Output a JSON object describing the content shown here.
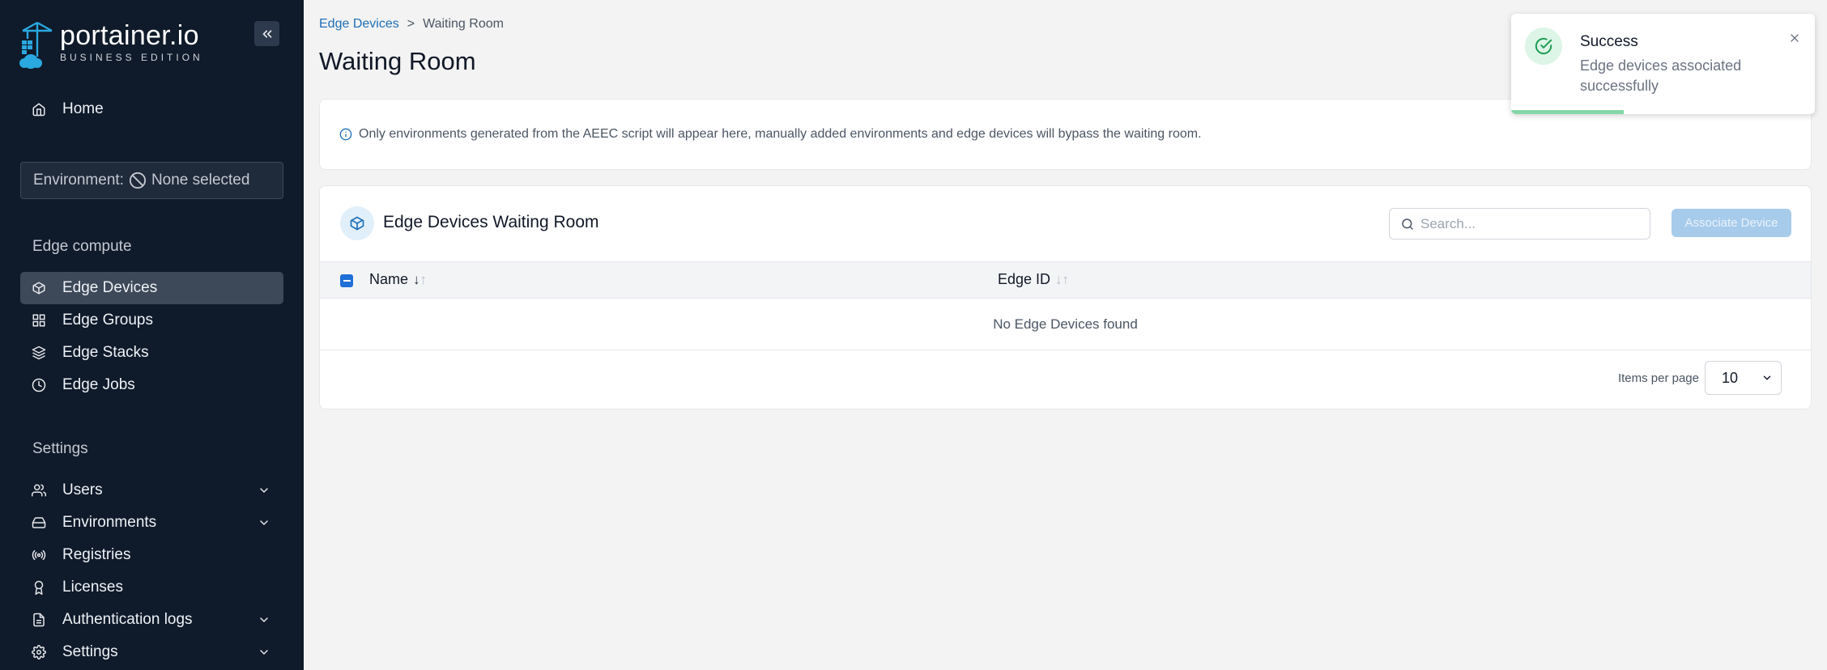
{
  "sidebar": {
    "logo_main": "portainer.io",
    "logo_sub": "BUSINESS EDITION",
    "home_label": "Home",
    "environment_label": "Environment:",
    "environment_value": "None selected",
    "edge_section_title": "Edge compute",
    "edge_items": [
      {
        "label": "Edge Devices",
        "icon": "box-icon",
        "active": true
      },
      {
        "label": "Edge Groups",
        "icon": "grid-icon"
      },
      {
        "label": "Edge Stacks",
        "icon": "layers-icon"
      },
      {
        "label": "Edge Jobs",
        "icon": "clock-icon"
      }
    ],
    "settings_section_title": "Settings",
    "settings_items": [
      {
        "label": "Users",
        "icon": "users-icon",
        "expandable": true
      },
      {
        "label": "Environments",
        "icon": "hard-drive-icon",
        "expandable": true
      },
      {
        "label": "Registries",
        "icon": "radio-icon"
      },
      {
        "label": "Licenses",
        "icon": "award-icon"
      },
      {
        "label": "Authentication logs",
        "icon": "file-text-icon",
        "expandable": true
      },
      {
        "label": "Settings",
        "icon": "gear-icon",
        "expandable": true
      }
    ]
  },
  "breadcrumb": {
    "link": "Edge Devices",
    "separator": ">",
    "current": "Waiting Room"
  },
  "page_title": "Waiting Room",
  "info_text": "Only environments generated from the AEEC script will appear here, manually added environments and edge devices will bypass the waiting room.",
  "table": {
    "title": "Edge Devices Waiting Room",
    "search_placeholder": "Search...",
    "associate_button": "Associate Device",
    "columns": [
      {
        "label": "Name",
        "sort": "↓",
        "sort_dim": "↑"
      },
      {
        "label": "Edge ID",
        "sort": "",
        "sort_dim": "↓↑"
      }
    ],
    "empty_message": "No Edge Devices found",
    "items_per_page_label": "Items per page",
    "items_per_page_value": "10"
  },
  "toast": {
    "title": "Success",
    "message": "Edge devices associated successfully",
    "progress": 0.37
  },
  "colors": {
    "sidebar_bg": "#0f1a2a",
    "accent": "#1d6fb8",
    "success": "#1f9d55"
  }
}
